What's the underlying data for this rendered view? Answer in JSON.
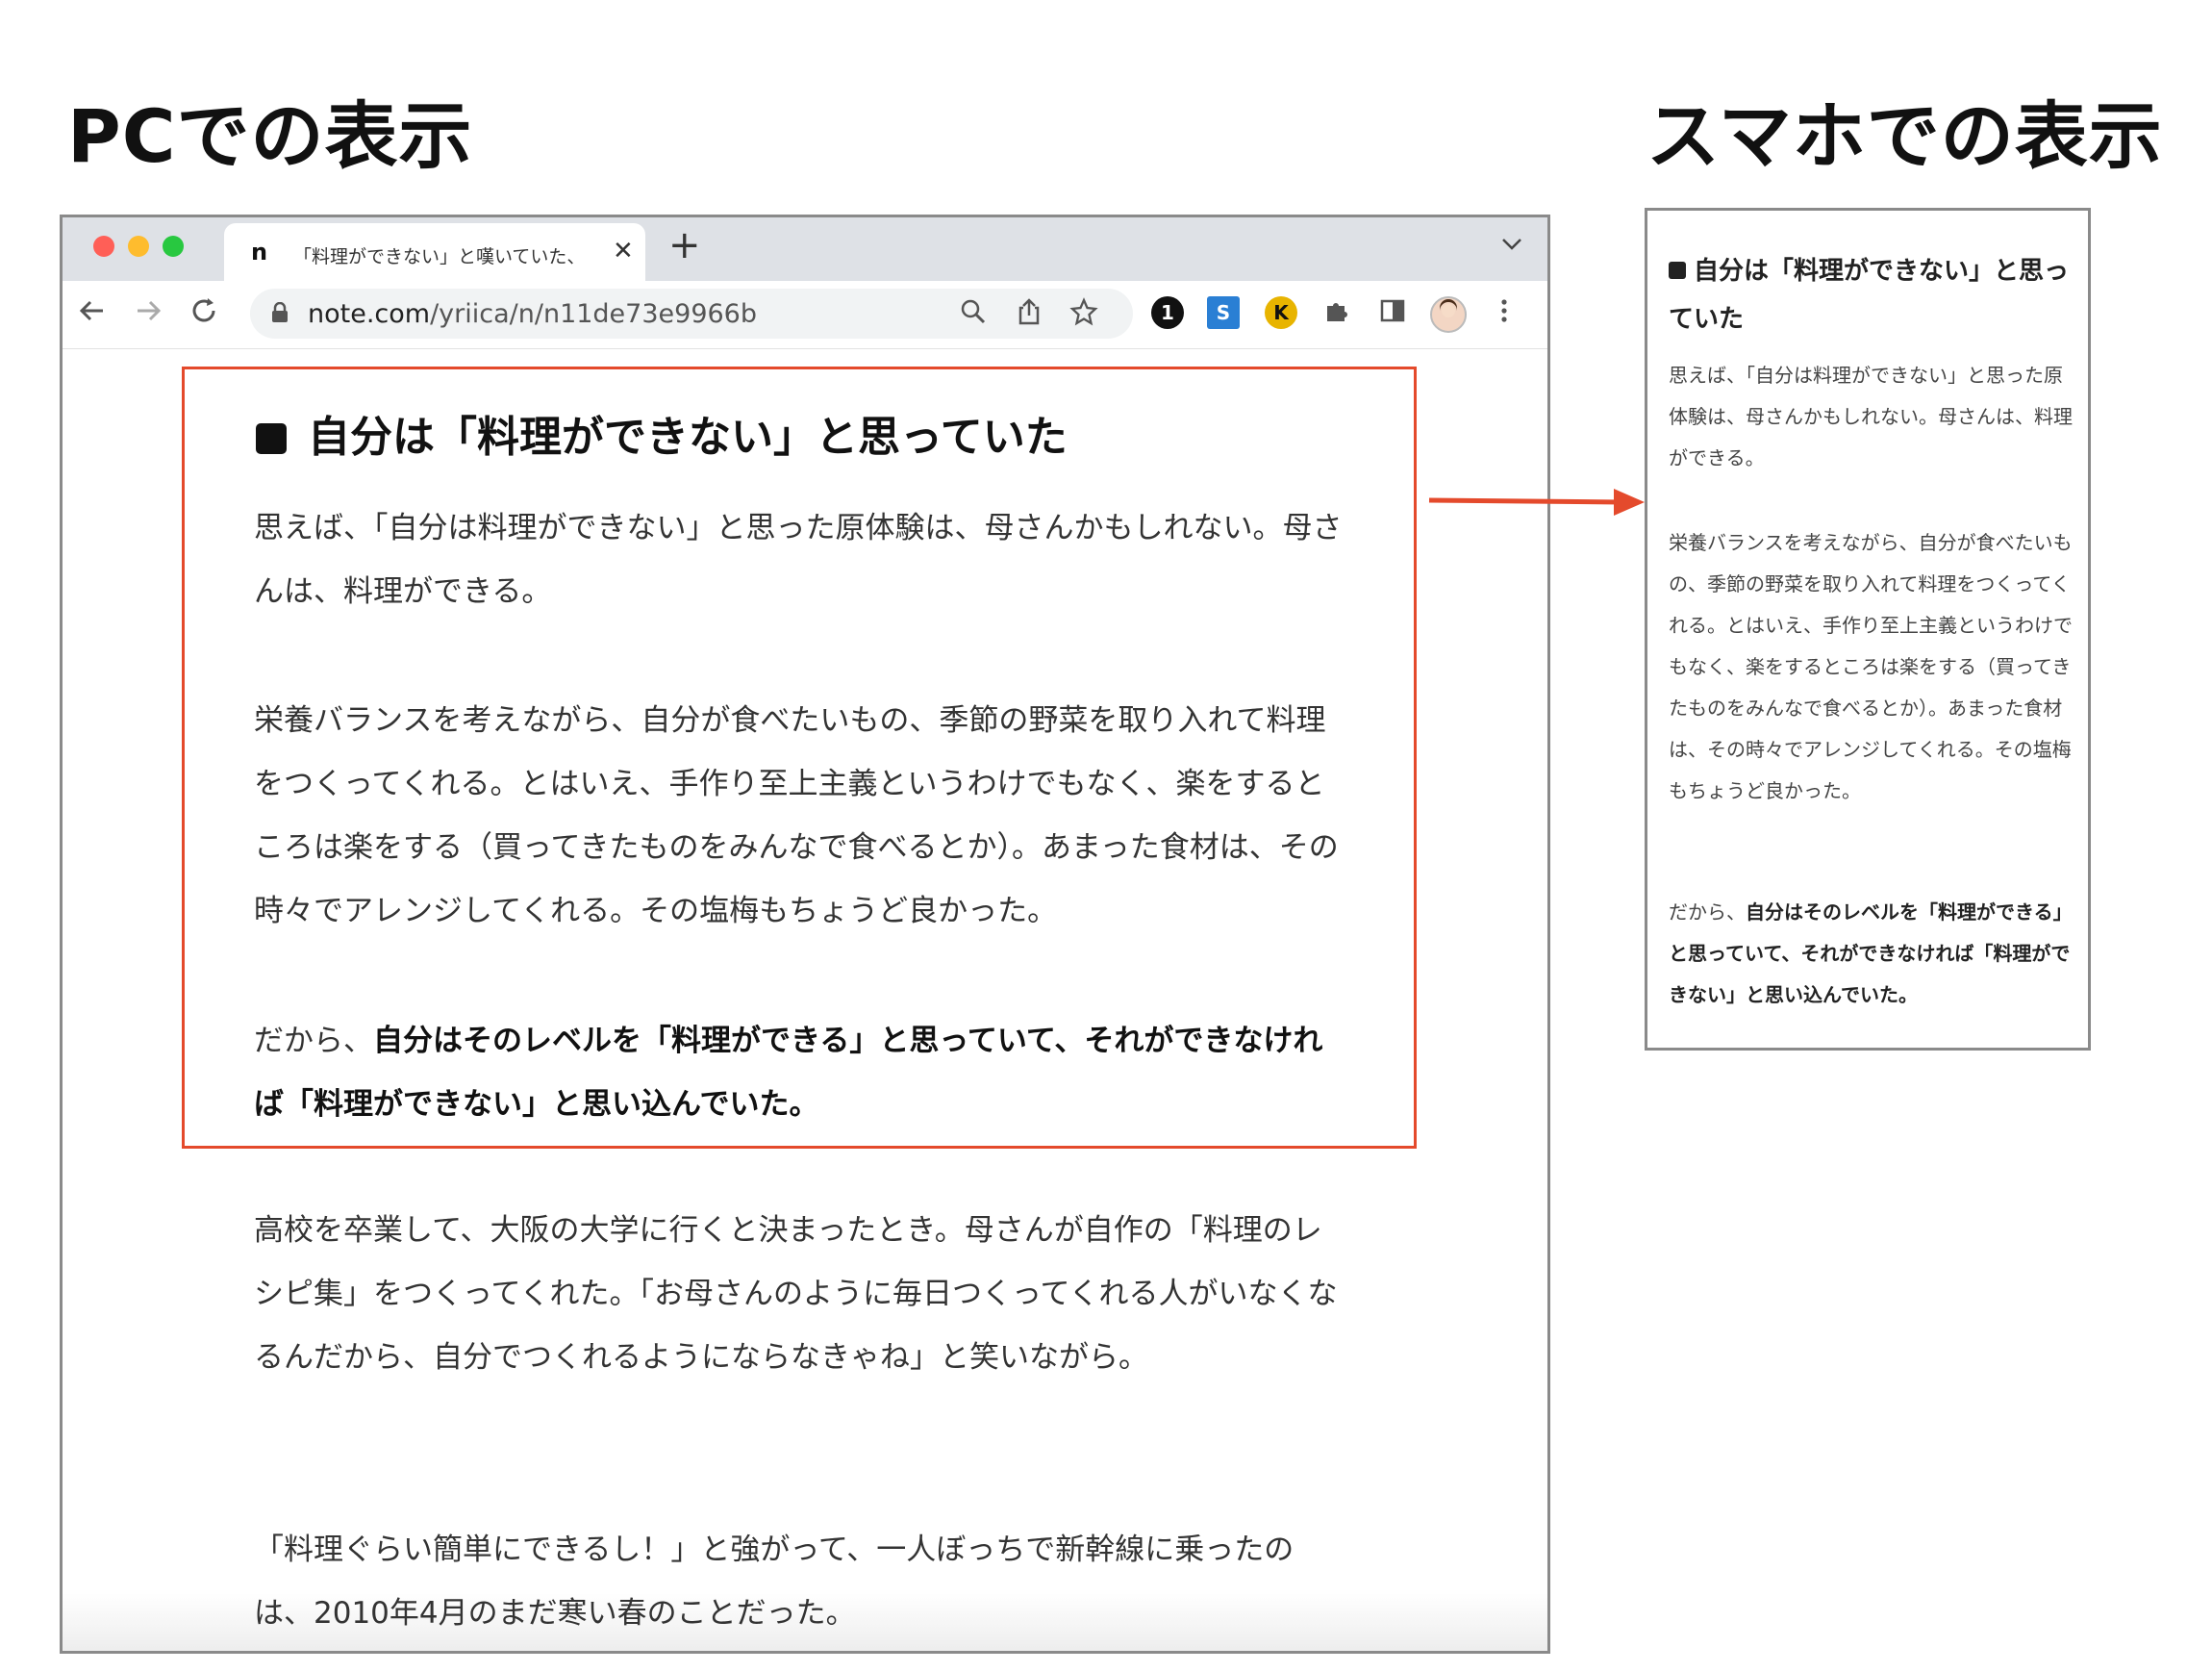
{
  "labels": {
    "pc": "PCでの表示",
    "smartphone": "スマホでの表示"
  },
  "browser": {
    "tab_favicon": "n",
    "tab_title": "「料理ができない」と嘆いていた、",
    "tab_close": "✕",
    "new_tab": "+",
    "tab_dropdown": "⌄",
    "url_domain": "note.com",
    "url_path": "/yriica/n/n11de73e9966b",
    "icons": [
      "back-arrow-icon",
      "forward-arrow-icon",
      "reload-icon",
      "lock-icon",
      "zoom-icon",
      "share-icon",
      "star-icon",
      "extension-1password-icon",
      "extension-s-icon",
      "extension-k-icon",
      "puzzle-icon",
      "sidepanel-icon",
      "profile-avatar-icon",
      "menu-dots-icon"
    ]
  },
  "pc_article": {
    "heading": "自分は「料理ができない」と思っていた",
    "p1": "思えば、「自分は料理ができない」と思った原体験は、母さんかもしれない。母さんは、料理ができる。",
    "p2": "栄養バランスを考えながら、自分が食べたいもの、季節の野菜を取り入れて料理をつくってくれる。とはいえ、手作り至上主義というわけでもなく、楽をするところは楽をする（買ってきたものをみんなで食べるとか）。あまった食材は、その時々でアレンジしてくれる。その塩梅もちょうど良かった。",
    "p3_normal": "だから、",
    "p3_bold": "自分はそのレベルを「料理ができる」と思っていて、それができなければ「料理ができない」と思い込んでいた。",
    "p4": "高校を卒業して、大阪の大学に行くと決まったとき。母さんが自作の「料理のレシピ集」をつくってくれた。「お母さんのように毎日つくってくれる人がいなくなるんだから、自分でつくれるようにならなきゃね」と笑いながら。",
    "p5": "「料理ぐらい簡単にできるし！」と強がって、一人ぼっちで新幹線に乗ったのは、2010年4月のまだ寒い春のことだった。"
  },
  "sp_article": {
    "heading": "自分は「料理ができない」と思っていた",
    "p1": "思えば、「自分は料理ができない」と思った原体験は、母さんかもしれない。母さんは、料理ができる。",
    "p2": "栄養バランスを考えながら、自分が食べたいもの、季節の野菜を取り入れて料理をつくってくれる。とはいえ、手作り至上主義というわけでもなく、楽をするところは楽をする（買ってきたものをみんなで食べるとか）。あまった食材は、その時々でアレンジしてくれる。その塩梅もちょうど良かった。",
    "p3_normal": "だから、",
    "p3_bold": "自分はそのレベルを「料理ができる」と思っていて、それができなければ「料理ができない」と思い込んでいた。"
  },
  "colors": {
    "highlight": "#e44a2c",
    "frame": "#8a8a8a",
    "tabbar": "#dee1e6"
  }
}
